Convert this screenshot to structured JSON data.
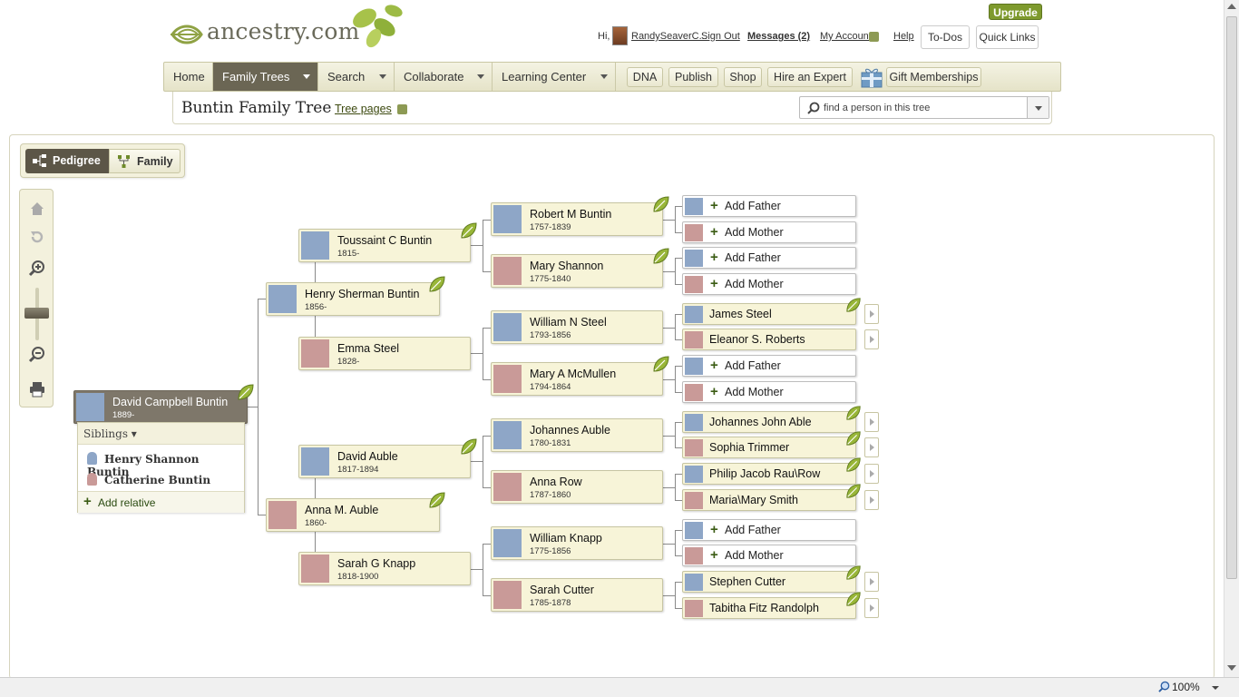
{
  "header": {
    "logo_text": "ancestry.com",
    "upgrade_label": "Upgrade",
    "greeting": "Hi,",
    "user_name": "RandySeaverC...",
    "sign_out": "Sign Out",
    "messages": "Messages (2)",
    "my_account": "My Account",
    "help": "Help",
    "todos": "To-Dos",
    "quick_links": "Quick Links"
  },
  "nav": {
    "items": [
      {
        "label": "Home"
      },
      {
        "label": "Family Trees"
      },
      {
        "label": "Search"
      },
      {
        "label": "Collaborate"
      },
      {
        "label": "Learning Center"
      }
    ],
    "buttons": [
      {
        "label": "DNA"
      },
      {
        "label": "Publish"
      },
      {
        "label": "Shop"
      },
      {
        "label": "Hire an Expert"
      },
      {
        "label": "Gift Memberships"
      }
    ]
  },
  "tree_bar": {
    "title": "Buntin Family Tree",
    "tree_pages": "Tree pages",
    "search_placeholder": "find a person in this tree"
  },
  "view": {
    "pedigree_label": "Pedigree",
    "family_label": "Family"
  },
  "tree": {
    "root": {
      "name": "David Campbell Buntin",
      "dates": "1889-"
    },
    "siblings": {
      "label": "Siblings ▾",
      "items": [
        {
          "name": "Henry Shannon Buntin",
          "gender": "male"
        },
        {
          "name": "Catherine Buntin",
          "gender": "female"
        }
      ],
      "add_relative": "Add relative"
    },
    "gen1": [
      {
        "name": "Henry Sherman Buntin",
        "dates": "1856-"
      },
      {
        "name": "Anna M. Auble",
        "dates": "1860-"
      }
    ],
    "gen2": [
      {
        "name": "Toussaint C Buntin",
        "dates": "1815-"
      },
      {
        "name": "Emma Steel",
        "dates": "1828-"
      },
      {
        "name": "David Auble",
        "dates": "1817-1894"
      },
      {
        "name": "Sarah G Knapp",
        "dates": "1818-1900"
      }
    ],
    "gen3": [
      {
        "name": "Robert M Buntin",
        "dates": "1757-1839"
      },
      {
        "name": "Mary Shannon",
        "dates": "1775-1840"
      },
      {
        "name": "William N Steel",
        "dates": "1793-1856"
      },
      {
        "name": "Mary A McMullen",
        "dates": "1794-1864"
      },
      {
        "name": "Johannes Auble",
        "dates": "1780-1831"
      },
      {
        "name": "Anna Row",
        "dates": "1787-1860"
      },
      {
        "name": "William Knapp",
        "dates": "1775-1856"
      },
      {
        "name": "Sarah Cutter",
        "dates": "1785-1878"
      }
    ],
    "gen4": [
      {
        "name": "Add Father"
      },
      {
        "name": "Add Mother"
      },
      {
        "name": "Add Father"
      },
      {
        "name": "Add Mother"
      },
      {
        "name": "James Steel"
      },
      {
        "name": "Eleanor S. Roberts"
      },
      {
        "name": "Add Father"
      },
      {
        "name": "Add Mother"
      },
      {
        "name": "Johannes John Able"
      },
      {
        "name": "Sophia Trimmer"
      },
      {
        "name": "Philip Jacob Rau\\Row"
      },
      {
        "name": "Maria\\Mary Smith"
      },
      {
        "name": "Add Father"
      },
      {
        "name": "Add Mother"
      },
      {
        "name": "Stephen Cutter"
      },
      {
        "name": "Tabitha Fitz Randolph"
      }
    ]
  },
  "status": {
    "zoom": "100%"
  },
  "colors": {
    "accent_green": "#7e9a2d",
    "nav_active": "#6b6654",
    "box_bg": "#f7f4d8",
    "male_photo": "#8ea6c7",
    "female_photo": "#c99a98"
  }
}
